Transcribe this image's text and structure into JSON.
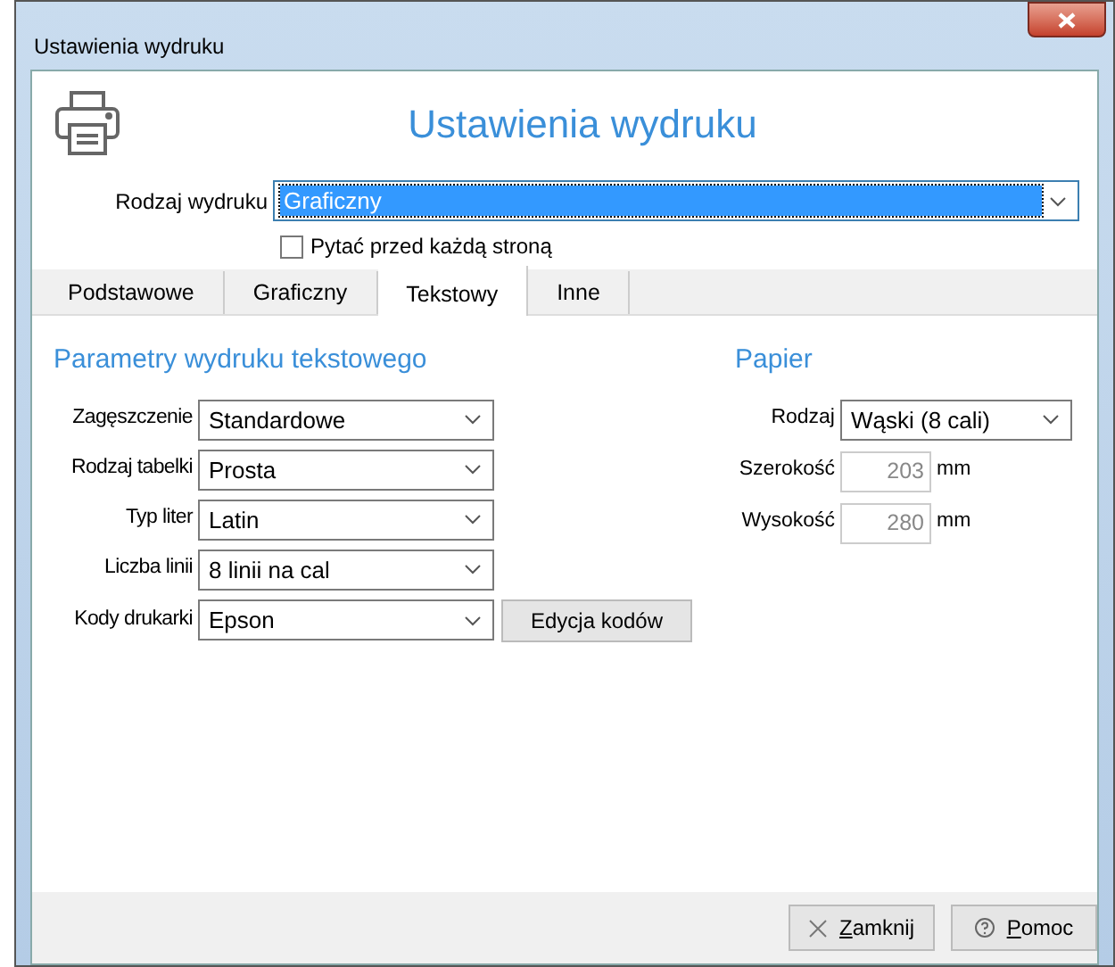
{
  "window": {
    "title": "Ustawienia wydruku"
  },
  "heading": "Ustawienia wydruku",
  "print_type": {
    "label": "Rodzaj wydruku",
    "value": "Graficzny",
    "focused": true
  },
  "ask_each_page": {
    "label": "Pytać przed każdą stroną",
    "checked": false
  },
  "tabs": [
    {
      "label": "Podstawowe",
      "selected": false
    },
    {
      "label": "Graficzny",
      "selected": false
    },
    {
      "label": "Tekstowy",
      "selected": true
    },
    {
      "label": "Inne",
      "selected": false
    }
  ],
  "text_params": {
    "title": "Parametry wydruku tekstowego",
    "fields": [
      {
        "label": "Zagęszczenie",
        "value": "Standardowe"
      },
      {
        "label": "Rodzaj tabelki",
        "value": "Prosta"
      },
      {
        "label": "Typ liter",
        "value": "Latin"
      },
      {
        "label": "Liczba linii",
        "value": "8 linii na cal"
      },
      {
        "label": "Kody drukarki",
        "value": "Epson",
        "button": "Edycja kodów"
      }
    ]
  },
  "paper": {
    "title": "Papier",
    "type": {
      "label": "Rodzaj",
      "value": "Wąski (8 cali)"
    },
    "dims": [
      {
        "label": "Szerokość",
        "value": "203",
        "unit": "mm",
        "disabled": true
      },
      {
        "label": "Wysokość",
        "value": "280",
        "unit": "mm",
        "disabled": true
      }
    ]
  },
  "buttons": [
    {
      "kind": "close",
      "label": "Zamknij"
    },
    {
      "kind": "help",
      "label": "Pomoc"
    }
  ]
}
